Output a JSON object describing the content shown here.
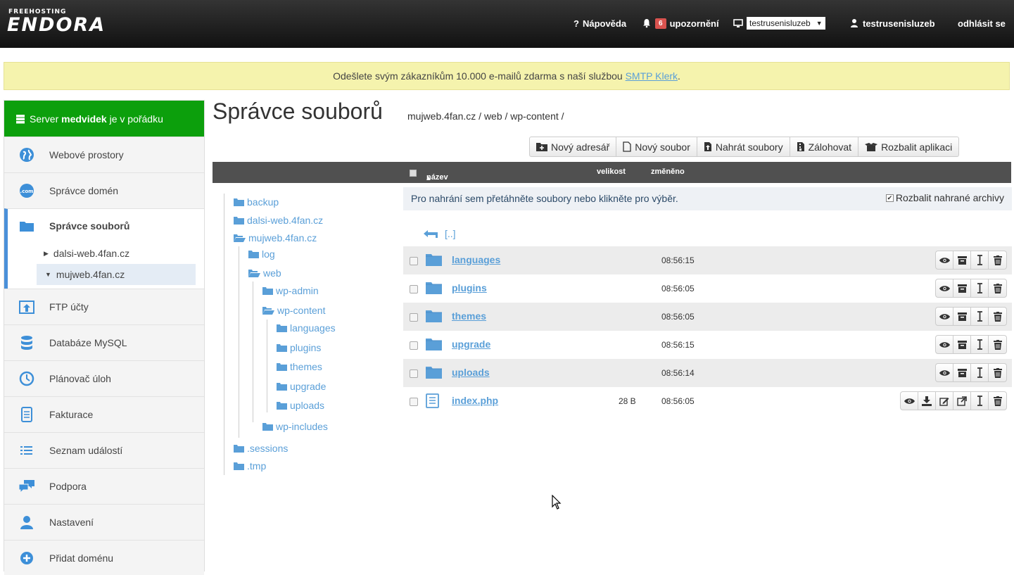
{
  "brand": {
    "small": "FREEHOSTING",
    "big": "ENDORA"
  },
  "topnav": {
    "help": "Nápověda",
    "notif_count": "6",
    "notif_label": "upozornění",
    "account_select": "testrusenisluzeb",
    "user": "testrusenisluzeb",
    "logout": "odhlásit se"
  },
  "notice": {
    "text": "Odešlete svým zákazníkům 10.000 e-mailů zdarma s naší službou ",
    "link": "SMTP Klerk",
    "suffix": "."
  },
  "sidebar": {
    "status_pre": "Server ",
    "status_name": "medvidek",
    "status_post": " je v pořádku",
    "items": [
      {
        "label": "Webové prostory",
        "icon": "globe-icon"
      },
      {
        "label": "Správce domén",
        "icon": "domain-icon"
      },
      {
        "label": "Správce souborů",
        "icon": "folder-icon"
      },
      {
        "label": "FTP účty",
        "icon": "upload-icon"
      },
      {
        "label": "Databáze MySQL",
        "icon": "database-icon"
      },
      {
        "label": "Plánovač úloh",
        "icon": "clock-icon"
      },
      {
        "label": "Fakturace",
        "icon": "invoice-icon"
      },
      {
        "label": "Seznam událostí",
        "icon": "list-icon"
      },
      {
        "label": "Podpora",
        "icon": "chat-icon"
      },
      {
        "label": "Nastavení",
        "icon": "user-icon"
      },
      {
        "label": "Přidat doménu",
        "icon": "plus-circle-icon"
      }
    ],
    "subitems": [
      "dalsi-web.4fan.cz",
      "mujweb.4fan.cz"
    ]
  },
  "page": {
    "title": "Správce souborů",
    "breadcrumb": "mujweb.4fan.cz / web / wp-content /"
  },
  "toolbar": {
    "new_dir": "Nový adresář",
    "new_file": "Nový soubor",
    "upload": "Nahrát soubory",
    "backup": "Zálohovat",
    "unpack": "Rozbalit aplikaci"
  },
  "columns": {
    "name": "název",
    "size": "velikost",
    "changed": "změněno"
  },
  "tree": [
    "backup",
    "dalsi-web.4fan.cz",
    "mujweb.4fan.cz",
    "log",
    "web",
    "wp-admin",
    "wp-content",
    "languages",
    "plugins",
    "themes",
    "upgrade",
    "uploads",
    "wp-includes",
    ".sessions",
    ".tmp"
  ],
  "dropzone": {
    "text": "Pro nahrání sem přetáhněte soubory nebo klikněte pro výběr.",
    "unpack_label": "Rozbalit nahrané archivy"
  },
  "parent_link": "[..]",
  "files": [
    {
      "name": "languages",
      "size": "",
      "time": "08:56:15",
      "type": "folder"
    },
    {
      "name": "plugins",
      "size": "",
      "time": "08:56:05",
      "type": "folder"
    },
    {
      "name": "themes",
      "size": "",
      "time": "08:56:05",
      "type": "folder"
    },
    {
      "name": "upgrade",
      "size": "",
      "time": "08:56:15",
      "type": "folder"
    },
    {
      "name": "uploads",
      "size": "",
      "time": "08:56:14",
      "type": "folder"
    },
    {
      "name": "index.php",
      "size": "28 B",
      "time": "08:56:05",
      "type": "file"
    }
  ],
  "colors": {
    "accent": "#5a9fd8",
    "status_green": "#0c9f0c",
    "badge_red": "#d9534f"
  }
}
